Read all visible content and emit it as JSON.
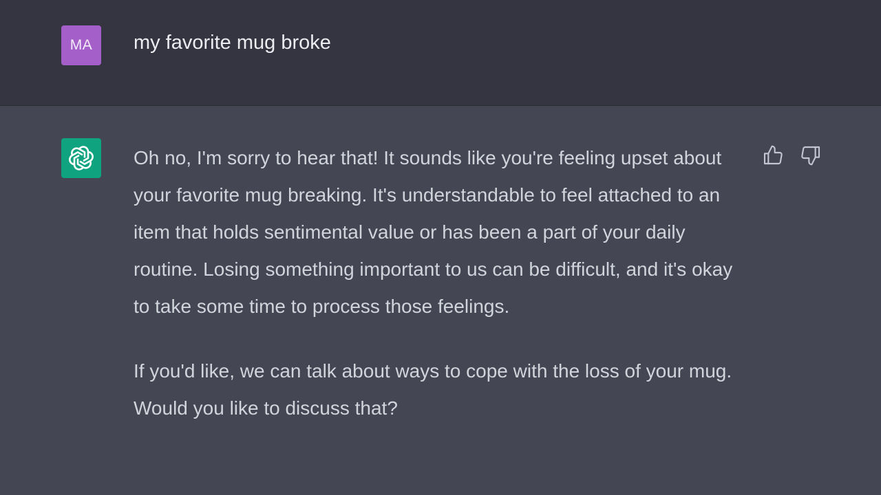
{
  "user_turn": {
    "avatar_initials": "MA",
    "avatar_color": "#a55fc9",
    "message": "my favorite mug broke"
  },
  "assistant_turn": {
    "avatar_icon": "openai-logo-icon",
    "avatar_color": "#10a37f",
    "paragraphs": [
      "Oh no, I'm sorry to hear that! It sounds like you're feeling upset about your favorite mug breaking. It's understandable to feel attached to an item that holds sentimental value or has been a part of your daily routine. Losing something important to us can be difficult, and it's okay to take some time to process those feelings.",
      "If you'd like, we can talk about ways to cope with the loss of your mug. Would you like to discuss that?"
    ],
    "feedback_icons": [
      "thumbs-up-icon",
      "thumbs-down-icon"
    ]
  }
}
